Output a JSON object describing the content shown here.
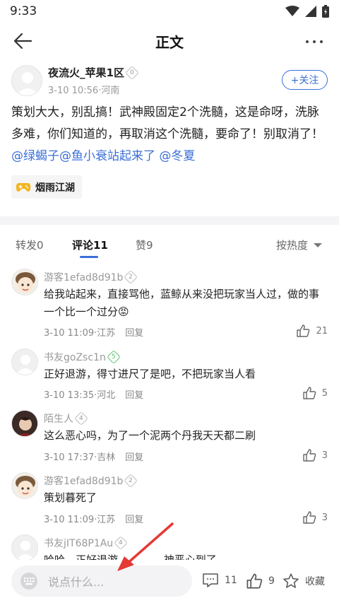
{
  "status_bar": {
    "time": "9:33",
    "icons": [
      "wifi-icon",
      "signal-icon",
      "battery-icon"
    ]
  },
  "nav": {
    "title": "正文",
    "back_icon": "back-arrow-icon",
    "more_icon": "more-icon"
  },
  "post": {
    "author": "夜流火_苹果1区",
    "level": "0",
    "date": "3-10",
    "time": "10:56",
    "location": "河南",
    "follow_label": "+关注",
    "body_text": "策划大大，别乱搞！武神殿固定2个洗髓，这是命呀，洗脉多难，你们知道的，再取消这个洗髓，要命了！别取消了！",
    "mentions": [
      "@绿蝎子",
      "@鱼小衰站起来了",
      "@冬夏"
    ],
    "tag": "烟雨江湖"
  },
  "tabs": {
    "items": [
      {
        "label": "转发0",
        "active": false
      },
      {
        "label": "评论11",
        "active": true
      },
      {
        "label": "赞9",
        "active": false
      }
    ],
    "sort_label": "按热度"
  },
  "comments": [
    {
      "name": "游客1efad8d91b",
      "level": "2",
      "text": "给我站起来，直接骂他，蓝鲸从来没把玩家当人过，做的事一个比一个过分",
      "emoji": "😡",
      "date": "3-10",
      "time": "11:09",
      "location": "江苏",
      "reply": "回复",
      "likes": "21"
    },
    {
      "name": "书友goZsc1n",
      "level": "5",
      "text": "正好退游，得寸进尺了是吧，不把玩家当人看",
      "date": "3-10",
      "time": "13:35",
      "location": "河北",
      "reply": "回复",
      "likes": "5"
    },
    {
      "name": "陌生人",
      "level": "4",
      "text": "这么恶心吗，为了一个泥两个丹我天天都二刷",
      "date": "3-10",
      "time": "17:37",
      "location": "吉林",
      "reply": "回复",
      "likes": "3"
    },
    {
      "name": "游客1efad8d91b",
      "level": "2",
      "text": "策划暮死了",
      "date": "3-10",
      "time": "11:09",
      "location": "江苏",
      "reply": "回复",
      "likes": "3"
    },
    {
      "name": "书友jIT68P1Au",
      "level": "4",
      "text": "哈哈，正好退游 …………神恶心到了",
      "date": "",
      "time": "",
      "location": "",
      "reply": "",
      "likes": ""
    }
  ],
  "bottom_bar": {
    "placeholder": "说点什么...",
    "comment_count": "11",
    "like_count": "9",
    "favorite_label": "收藏"
  },
  "colors": {
    "accent": "#3a6fd8",
    "annotation_arrow": "#e53935",
    "level_green": "#5bbf6b"
  }
}
